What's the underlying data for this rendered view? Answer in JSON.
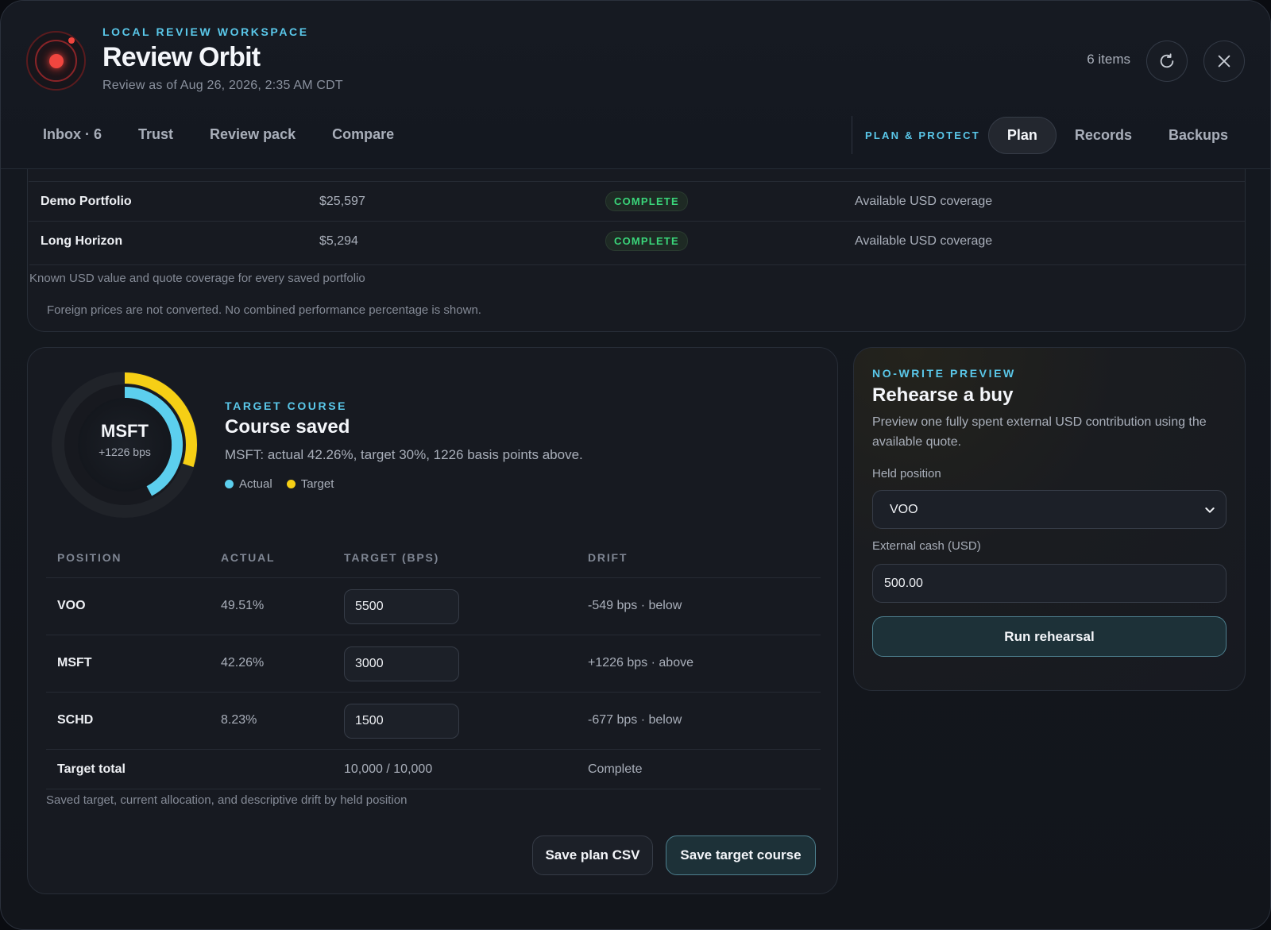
{
  "header": {
    "eyebrow": "LOCAL REVIEW WORKSPACE",
    "title": "Review Orbit",
    "subtitle": "Review as of Aug 26, 2026, 2:35 AM CDT",
    "items_count": "6 items"
  },
  "nav": {
    "left_tabs": [
      {
        "label": "Inbox · 6"
      },
      {
        "label": "Trust"
      },
      {
        "label": "Review pack"
      },
      {
        "label": "Compare"
      }
    ],
    "section_eyebrow": "PLAN & PROTECT",
    "right_tabs": [
      {
        "label": "Plan",
        "active": true
      },
      {
        "label": "Records"
      },
      {
        "label": "Backups"
      }
    ]
  },
  "coverage": {
    "rows": [
      {
        "name": "Demo Portfolio",
        "value": "$25,597",
        "status": "COMPLETE",
        "note": "Available USD coverage"
      },
      {
        "name": "Long Horizon",
        "value": "$5,294",
        "status": "COMPLETE",
        "note": "Available USD coverage"
      }
    ],
    "caption": "Known USD value and quote coverage for every saved portfolio",
    "footnote": "Foreign prices are not converted. No combined performance percentage is shown."
  },
  "plan": {
    "donut": {
      "symbol": "MSFT",
      "sub": "+1226 bps",
      "actual_fraction": 0.4226,
      "target_fraction": 0.3
    },
    "eyebrow": "TARGET COURSE",
    "title": "Course saved",
    "description": "MSFT: actual 42.26%, target 30%, 1226 basis points above.",
    "legend": {
      "actual": "Actual",
      "target": "Target"
    },
    "colors": {
      "actual": "#5ccfee",
      "target": "#f6cf15",
      "status_complete": "#3ad67a",
      "accent": "#5ac8ea"
    },
    "columns": {
      "position": "POSITION",
      "actual": "ACTUAL",
      "target": "TARGET (BPS)",
      "drift": "DRIFT"
    },
    "rows": [
      {
        "symbol": "VOO",
        "actual": "49.51%",
        "target": "5500",
        "drift": "-549 bps · below"
      },
      {
        "symbol": "MSFT",
        "actual": "42.26%",
        "target": "3000",
        "drift": "+1226 bps · above"
      },
      {
        "symbol": "SCHD",
        "actual": "8.23%",
        "target": "1500",
        "drift": "-677 bps · below"
      }
    ],
    "total": {
      "label": "Target total",
      "value": "10,000 / 10,000",
      "status": "Complete"
    },
    "caption": "Saved target, current allocation, and descriptive drift by held position",
    "save_csv": "Save plan CSV",
    "save_target": "Save target course"
  },
  "rehearse": {
    "eyebrow": "NO-WRITE PREVIEW",
    "title": "Rehearse a buy",
    "description": "Preview one fully spent external USD contribution using the available quote.",
    "held_label": "Held position",
    "held_value": "VOO",
    "cash_label": "External cash (USD)",
    "cash_value": "500.00",
    "run_label": "Run rehearsal"
  }
}
